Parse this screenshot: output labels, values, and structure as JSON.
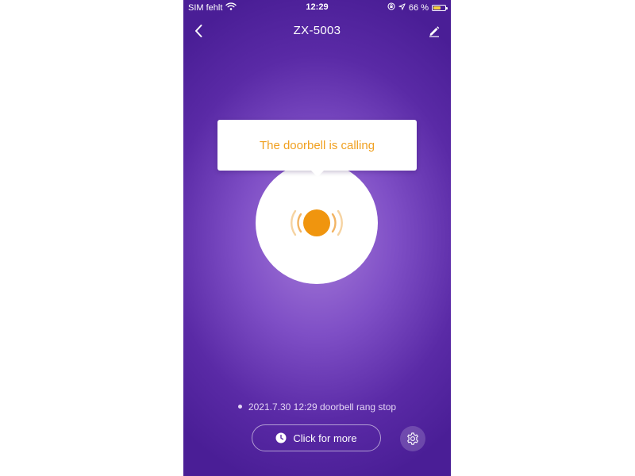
{
  "status_bar": {
    "carrier": "SIM fehlt",
    "time": "12:29",
    "battery_text": "66 %",
    "battery_level": 0.66,
    "icons": [
      "wifi-icon",
      "orientation-lock-icon",
      "location-arrow-icon",
      "battery-icon"
    ]
  },
  "nav": {
    "title": "ZX-5003",
    "back_icon": "chevron-left-icon",
    "edit_icon": "pencil-icon"
  },
  "doorbell": {
    "tooltip": "The doorbell is calling",
    "icon": "ringing-bell-icon"
  },
  "log": {
    "last_event": "2021.7.30 12:29 doorbell rang stop"
  },
  "actions": {
    "more_label": "Click for more",
    "more_icon": "clock-icon",
    "settings_icon": "gear-icon"
  },
  "colors": {
    "accent_orange": "#f0a020",
    "background_purple": "#5a2aa6",
    "battery_yellow": "#f4d03f"
  }
}
